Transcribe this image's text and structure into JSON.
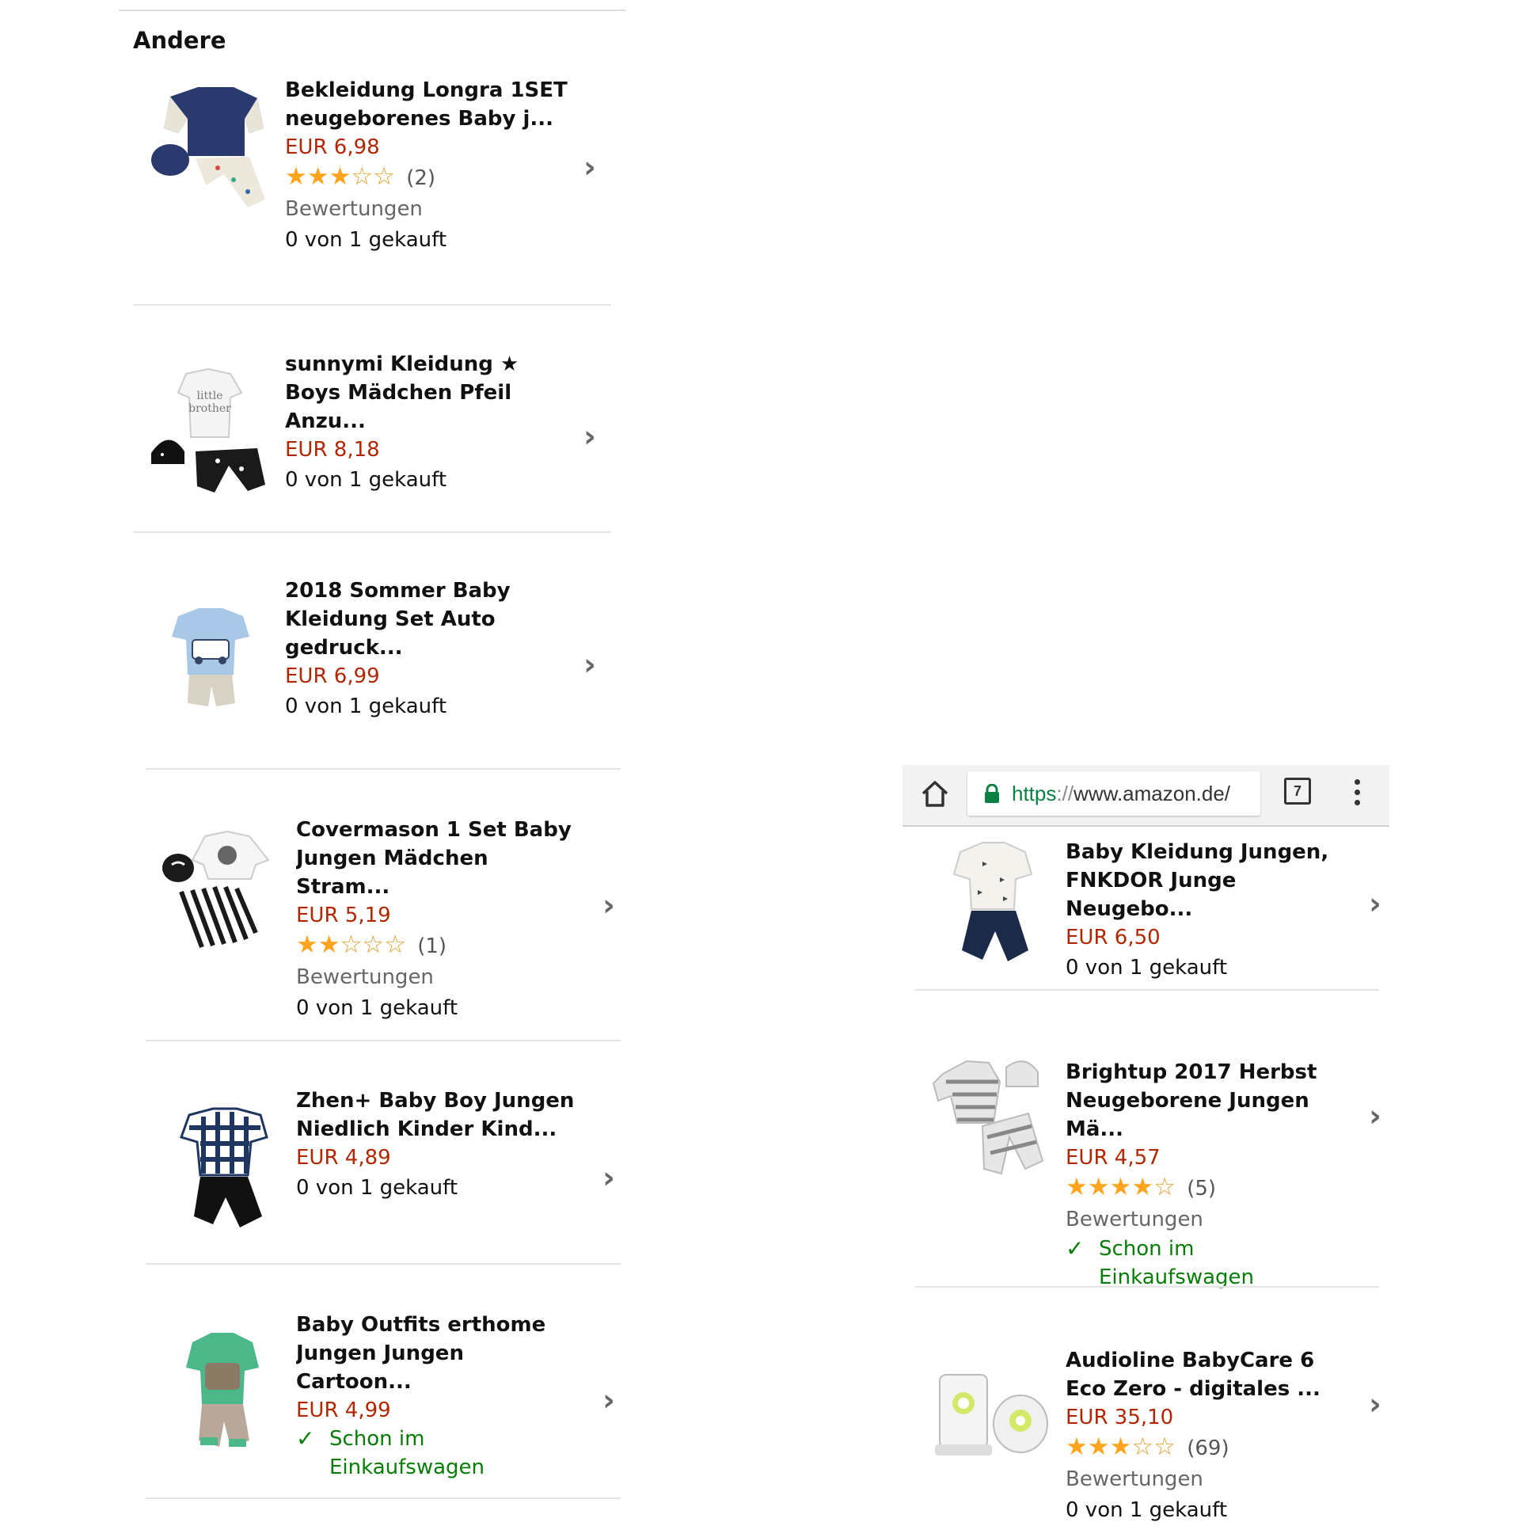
{
  "left": {
    "section_title": "Andere",
    "products": [
      {
        "title": "Bekleidung Longra 1SET neugeborenes Baby j...",
        "price": "EUR 6,98",
        "rating": {
          "stars": 3,
          "count": "(2)",
          "reviews_label": "Bewertungen"
        },
        "bought": "0 von 1 gekauft"
      },
      {
        "title": "sunnymi Kleidung ★ Boys Mädchen Pfeil Anzu...",
        "price": "EUR 8,18",
        "bought": "0 von 1 gekauft"
      },
      {
        "title": "2018 Sommer Baby Kleidung Set Auto gedruck...",
        "price": "EUR 6,99",
        "bought": "0 von 1 gekauft"
      },
      {
        "title": "Covermason 1 Set Baby Jungen Mädchen Stram...",
        "price": "EUR 5,19",
        "rating": {
          "stars": 2,
          "count": "(1)",
          "reviews_label": "Bewertungen"
        },
        "bought": "0 von 1 gekauft"
      },
      {
        "title": "Zhen+ Baby Boy Jungen Niedlich Kinder Kind...",
        "price": "EUR 4,89",
        "bought": "0 von 1 gekauft"
      },
      {
        "title": "Baby Outfits erthome Jungen Jungen Cartoon...",
        "price": "EUR 4,99",
        "in_cart": "Schon im Einkaufswagen"
      }
    ]
  },
  "right": {
    "browser": {
      "url_scheme": "https",
      "url_sep": "://",
      "url_host": "www.amazon.de/",
      "tab_count": "7",
      "home_icon": "home-icon",
      "lock_icon": "lock-icon",
      "menu_icon": "more-vert-icon"
    },
    "products": [
      {
        "title": "Baby Kleidung Jungen, FNKDOR Junge Neugebo...",
        "price": "EUR 6,50",
        "bought": "0 von 1 gekauft"
      },
      {
        "title": "Brightup 2017 Herbst Neugeborene Jungen Mä...",
        "price": "EUR 4,57",
        "rating": {
          "stars": 4,
          "count": "(5)",
          "reviews_label": "Bewertungen"
        },
        "in_cart": "Schon im Einkaufswagen"
      },
      {
        "title": "Audioline BabyCare 6 Eco Zero - digitales ...",
        "price": "EUR 35,10",
        "rating": {
          "stars": 3,
          "count": "(69)",
          "reviews_label": "Bewertungen"
        },
        "bought": "0 von 1 gekauft"
      }
    ]
  },
  "colors": {
    "price": "#b12704",
    "star": "#ffa41c",
    "in_cart": "#067d06",
    "secure": "#0b8043"
  }
}
